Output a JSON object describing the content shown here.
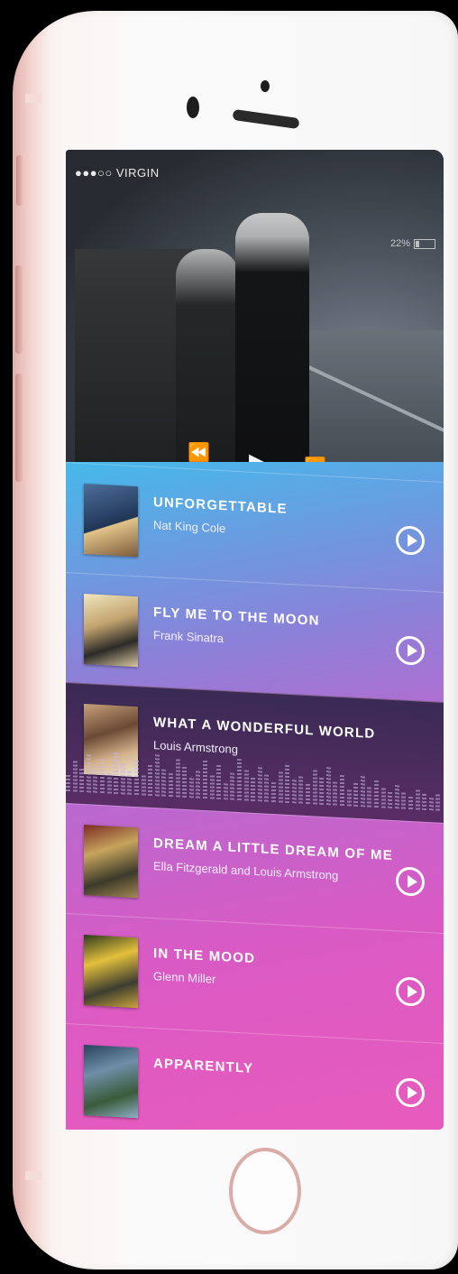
{
  "status_bar": {
    "carrier": "●●●○○ VIRGIN",
    "battery": "22%"
  },
  "player": {
    "rewind_symbol": "⏪",
    "play_symbol": "▶",
    "forward_symbol": "⏩",
    "progress": 0.05,
    "accent_color": "#e74a6a"
  },
  "tracks": [
    {
      "title": "UNFORGETTABLE",
      "artist": "Nat King Cole",
      "active": false
    },
    {
      "title": "FLY ME TO THE MOON",
      "artist": "Frank Sinatra",
      "active": false
    },
    {
      "title": "WHAT A WONDERFUL WORLD",
      "artist": "Louis Armstrong",
      "active": true
    },
    {
      "title": "DREAM A LITTLE DREAM OF ME",
      "artist": "Ella Fitzgerald  and Louis Armstrong",
      "active": false
    },
    {
      "title": "IN THE MOOD",
      "artist": "Glenn Miller",
      "active": false
    },
    {
      "title": "APPARENTLY",
      "artist": "",
      "active": false
    }
  ],
  "colors": {
    "list_gradient_start": "#46b9ea",
    "list_gradient_end": "#e85bbd",
    "phone_body": "#f7f7f7",
    "phone_trim": "#e2b1ad"
  }
}
